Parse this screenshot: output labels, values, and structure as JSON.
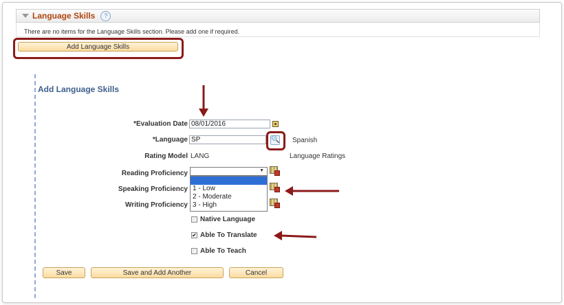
{
  "section": {
    "title": "Language Skills",
    "help_icon": "?",
    "empty_message": "There are no items for the Language Skills section.  Please add one if required.",
    "add_button": "Add Language Skills"
  },
  "form": {
    "title": "Add Language Skills",
    "evaluation_date_label": "*Evaluation Date",
    "evaluation_date_value": "08/01/2016",
    "language_label": "*Language",
    "language_value": "SP",
    "language_desc": "Spanish",
    "rating_model_label": "Rating Model",
    "rating_model_value": "LANG",
    "rating_model_desc": "Language Ratings",
    "reading_label": "Reading Proficiency",
    "speaking_label": "Speaking Proficiency",
    "writing_label": "Writing Proficiency",
    "reading_value": "",
    "dropdown_options": [
      "",
      "1 - Low",
      "2 - Moderate",
      "3 - High"
    ],
    "native_language_label": "Native Language",
    "able_to_translate_label": "Able To Translate",
    "able_to_teach_label": "Able To Teach",
    "able_to_translate_checked": "✔"
  },
  "buttons": {
    "save": "Save",
    "save_add_another": "Save and Add Another",
    "cancel": "Cancel"
  },
  "colors": {
    "annotation": "#8b1a1a",
    "section_title": "#b0460f",
    "page_title": "#3d5f8c"
  }
}
